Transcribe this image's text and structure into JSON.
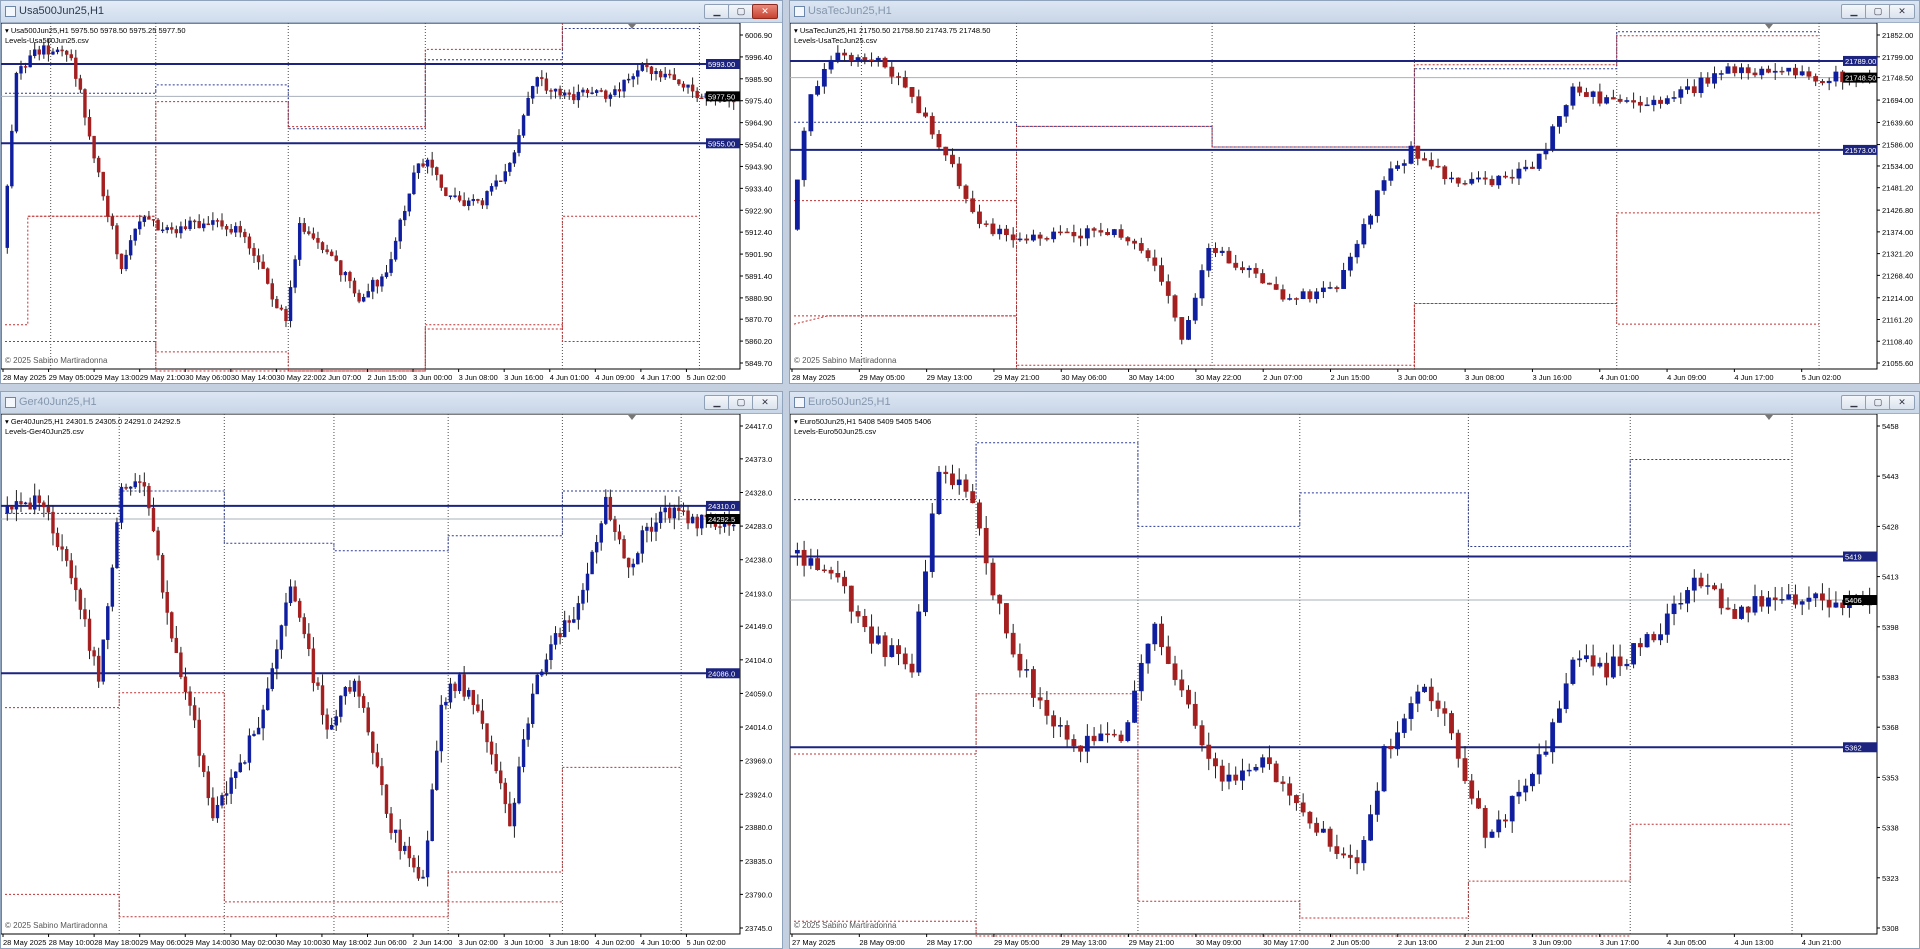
{
  "colors": {
    "bull": "#0f1e9e",
    "bear": "#a41f1f",
    "level": "#1c2480",
    "bid": "#aab0bb",
    "sep": "#4e4e4e",
    "red_dot": "#c03030"
  },
  "windows": [
    {
      "title": "Usa500Jun25,H1"
    },
    {
      "title": "UsaTecJun25,H1"
    },
    {
      "title": "Ger40Jun25,H1"
    },
    {
      "title": "Euro50Jun25,H1"
    }
  ],
  "chart_data": [
    {
      "type": "candlestick",
      "symbol_line": "Usa500Jun25,H1  5975.50 5978.50 5975.25 5977.50",
      "indicator": "Levels-Usa500Jun25.csv",
      "copyright": "© 2025 Sabino Martiradonna",
      "ylim": [
        5849.7,
        6006.9
      ],
      "yticks": [
        "6006.90",
        "5996.40",
        "5985.90",
        "5975.40",
        "5964.90",
        "5954.40",
        "5943.90",
        "5933.40",
        "5922.90",
        "5912.40",
        "5901.90",
        "5891.40",
        "5880.90",
        "5870.70",
        "5860.20",
        "5849.70"
      ],
      "xticks": [
        "28 May 2025",
        "29 May 05:00",
        "29 May 13:00",
        "29 May 21:00",
        "30 May 06:00",
        "30 May 14:00",
        "30 May 22:00",
        "2 Jun 07:00",
        "2 Jun 15:00",
        "3 Jun 00:00",
        "3 Jun 08:00",
        "3 Jun 16:00",
        "4 Jun 01:00",
        "4 Jun 09:00",
        "4 Jun 17:00",
        "5 Jun 02:00"
      ],
      "n_candles": 160,
      "levels": [
        {
          "value": 5993.0,
          "label": "5993.00"
        },
        {
          "value": 5955.0,
          "label": "5955.00"
        }
      ],
      "bid": {
        "value": 5977.5,
        "label": "5977.50"
      },
      "separators": [
        10,
        33,
        62,
        92,
        122,
        152
      ],
      "path": [
        [
          0,
          5905
        ],
        [
          3,
          5990
        ],
        [
          8,
          6000
        ],
        [
          15,
          5998
        ],
        [
          20,
          5950
        ],
        [
          26,
          5895
        ],
        [
          31,
          5922
        ],
        [
          36,
          5912
        ],
        [
          45,
          5918
        ],
        [
          52,
          5913
        ],
        [
          58,
          5888
        ],
        [
          62,
          5868
        ],
        [
          65,
          5915
        ],
        [
          70,
          5905
        ],
        [
          78,
          5882
        ],
        [
          84,
          5892
        ],
        [
          90,
          5940
        ],
        [
          93,
          5948
        ],
        [
          98,
          5928
        ],
        [
          104,
          5925
        ],
        [
          111,
          5945
        ],
        [
          116,
          5985
        ],
        [
          125,
          5978
        ],
        [
          133,
          5978
        ],
        [
          140,
          5990
        ],
        [
          147,
          5987
        ],
        [
          152,
          5978
        ],
        [
          159,
          5977
        ]
      ],
      "red_upper": [
        [
          0,
          null
        ],
        [
          5,
          5920
        ],
        [
          33,
          5920
        ],
        [
          33,
          5975
        ],
        [
          62,
          5975
        ],
        [
          62,
          5963
        ],
        [
          92,
          5963
        ],
        [
          92,
          6000
        ],
        [
          122,
          6000
        ],
        [
          122,
          6015
        ],
        [
          152,
          6015
        ],
        [
          152,
          6030
        ]
      ],
      "red_lower": [
        [
          0,
          5868
        ],
        [
          5,
          5868
        ],
        [
          5,
          5920
        ],
        [
          33,
          5920
        ],
        [
          33,
          5855
        ],
        [
          62,
          5855
        ],
        [
          62,
          5842
        ],
        [
          92,
          5842
        ],
        [
          92,
          5866
        ],
        [
          122,
          5866
        ],
        [
          122,
          5920
        ],
        [
          152,
          5920
        ]
      ],
      "red_lower2": [
        [
          0,
          5860
        ],
        [
          33,
          5860
        ],
        [
          33,
          5845
        ],
        [
          62,
          5845
        ],
        [
          92,
          5845
        ],
        [
          92,
          5868
        ],
        [
          122,
          5868
        ],
        [
          122,
          5860
        ],
        [
          152,
          5860
        ]
      ],
      "upper_dotted_blue": [
        [
          0,
          5979
        ],
        [
          33,
          5979
        ],
        [
          33,
          5983
        ],
        [
          62,
          5983
        ],
        [
          62,
          5962
        ],
        [
          92,
          5962
        ],
        [
          92,
          5995
        ],
        [
          122,
          5995
        ],
        [
          122,
          6010
        ],
        [
          152,
          6010
        ]
      ]
    },
    {
      "type": "candlestick",
      "symbol_line": "UsaTecJun25,H1  21750.50 21758.50 21743.75 21748.50",
      "indicator": "Levels-UsaTecJun25.csv",
      "copyright": "© 2025 Sabino Martiradonna",
      "ylim": [
        21055.6,
        21852.0
      ],
      "yticks": [
        "21852.00",
        "21799.00",
        "21748.50",
        "21694.00",
        "21639.60",
        "21586.00",
        "21534.00",
        "21481.20",
        "21426.80",
        "21374.00",
        "21321.20",
        "21268.40",
        "21214.00",
        "21161.20",
        "21108.40",
        "21055.60"
      ],
      "xticks": [
        "28 May 2025",
        "29 May 05:00",
        "29 May 13:00",
        "29 May 21:00",
        "30 May 06:00",
        "30 May 14:00",
        "30 May 22:00",
        "2 Jun 07:00",
        "2 Jun 15:00",
        "3 Jun 00:00",
        "3 Jun 08:00",
        "3 Jun 16:00",
        "4 Jun 01:00",
        "4 Jun 09:00",
        "4 Jun 17:00",
        "5 Jun 02:00"
      ],
      "n_candles": 160,
      "levels": [
        {
          "value": 21789.0,
          "label": "21789.00"
        },
        {
          "value": 21573.0,
          "label": "21573.00"
        }
      ],
      "bid": {
        "value": 21748.5,
        "label": "21748.50"
      },
      "separators": [
        10,
        33,
        62,
        92,
        122,
        152
      ],
      "path": [
        [
          0,
          21380
        ],
        [
          3,
          21720
        ],
        [
          7,
          21800
        ],
        [
          13,
          21790
        ],
        [
          18,
          21700
        ],
        [
          23,
          21560
        ],
        [
          28,
          21390
        ],
        [
          34,
          21360
        ],
        [
          41,
          21365
        ],
        [
          48,
          21380
        ],
        [
          54,
          21300
        ],
        [
          58,
          21115
        ],
        [
          62,
          21330
        ],
        [
          66,
          21300
        ],
        [
          74,
          21210
        ],
        [
          81,
          21230
        ],
        [
          88,
          21500
        ],
        [
          92,
          21570
        ],
        [
          97,
          21510
        ],
        [
          104,
          21490
        ],
        [
          111,
          21550
        ],
        [
          116,
          21720
        ],
        [
          124,
          21680
        ],
        [
          131,
          21700
        ],
        [
          138,
          21760
        ],
        [
          145,
          21770
        ],
        [
          150,
          21750
        ],
        [
          159,
          21748
        ]
      ],
      "red_upper": [
        [
          0,
          21150
        ],
        [
          5,
          21170
        ],
        [
          33,
          21170
        ],
        [
          33,
          21630
        ],
        [
          62,
          21630
        ],
        [
          62,
          21580
        ],
        [
          92,
          21580
        ],
        [
          92,
          21780
        ],
        [
          122,
          21780
        ],
        [
          122,
          21850
        ],
        [
          152,
          21850
        ]
      ],
      "red_lower": [
        [
          0,
          21450
        ],
        [
          5,
          21450
        ],
        [
          33,
          21450
        ],
        [
          33,
          21050
        ],
        [
          62,
          21050
        ],
        [
          92,
          21050
        ],
        [
          92,
          21200
        ],
        [
          122,
          21200
        ],
        [
          122,
          21420
        ],
        [
          152,
          21420
        ]
      ],
      "red_lower2": [
        [
          0,
          21170
        ],
        [
          33,
          21170
        ],
        [
          33,
          21040
        ],
        [
          62,
          21040
        ],
        [
          92,
          21040
        ],
        [
          92,
          21200
        ],
        [
          122,
          21200
        ],
        [
          122,
          21150
        ],
        [
          152,
          21150
        ]
      ],
      "upper_dotted_blue": [
        [
          0,
          21640
        ],
        [
          33,
          21640
        ],
        [
          33,
          21630
        ],
        [
          62,
          21630
        ],
        [
          62,
          21580
        ],
        [
          92,
          21580
        ],
        [
          92,
          21770
        ],
        [
          122,
          21770
        ],
        [
          122,
          21860
        ],
        [
          152,
          21860
        ]
      ]
    },
    {
      "type": "candlestick",
      "symbol_line": "Ger40Jun25,H1  24301.5 24305.0 24291.0 24292.5",
      "indicator": "Levels-Ger40Jun25.csv",
      "copyright": "© 2025 Sabino Martiradonna",
      "ylim": [
        23745.0,
        24417.0
      ],
      "yticks": [
        "24417.0",
        "24373.0",
        "24328.0",
        "24283.0",
        "24238.0",
        "24193.0",
        "24149.0",
        "24104.0",
        "24059.0",
        "24014.0",
        "23969.0",
        "23924.0",
        "23880.0",
        "23835.0",
        "23790.0",
        "23745.0"
      ],
      "xticks": [
        "28 May 2025",
        "28 May 10:00",
        "28 May 18:00",
        "29 May 06:00",
        "29 May 14:00",
        "30 May 02:00",
        "30 May 10:00",
        "30 May 18:00",
        "2 Jun 06:00",
        "2 Jun 14:00",
        "3 Jun 02:00",
        "3 Jun 10:00",
        "3 Jun 18:00",
        "4 Jun 02:00",
        "4 Jun 10:00",
        "5 Jun 02:00"
      ],
      "n_candles": 160,
      "levels": [
        {
          "value": 24310.0,
          "label": "24310.0"
        },
        {
          "value": 24086.0,
          "label": "24086.0"
        }
      ],
      "bid": {
        "value": 24292.5,
        "label": "24292.5"
      },
      "separators": [
        25,
        48,
        72,
        97,
        122,
        148
      ],
      "path": [
        [
          0,
          24300
        ],
        [
          8,
          24320
        ],
        [
          14,
          24230
        ],
        [
          21,
          24085
        ],
        [
          26,
          24340
        ],
        [
          31,
          24340
        ],
        [
          36,
          24170
        ],
        [
          41,
          24040
        ],
        [
          46,
          23900
        ],
        [
          52,
          23960
        ],
        [
          57,
          24040
        ],
        [
          63,
          24210
        ],
        [
          71,
          24010
        ],
        [
          77,
          24080
        ],
        [
          85,
          23880
        ],
        [
          92,
          23810
        ],
        [
          96,
          24040
        ],
        [
          100,
          24080
        ],
        [
          106,
          24000
        ],
        [
          111,
          23885
        ],
        [
          116,
          24060
        ],
        [
          121,
          24130
        ],
        [
          126,
          24170
        ],
        [
          132,
          24320
        ],
        [
          137,
          24220
        ],
        [
          140,
          24270
        ],
        [
          145,
          24300
        ],
        [
          152,
          24292
        ]
      ],
      "red_upper": [
        [
          0,
          24040
        ],
        [
          25,
          24040
        ],
        [
          25,
          24060
        ],
        [
          48,
          24060
        ],
        [
          48,
          23780
        ],
        [
          97,
          23780
        ],
        [
          97,
          23820
        ],
        [
          122,
          23820
        ],
        [
          122,
          23960
        ],
        [
          148,
          23960
        ]
      ],
      "red_lower": [
        [
          0,
          23790
        ],
        [
          25,
          23790
        ],
        [
          25,
          23760
        ],
        [
          48,
          23760
        ],
        [
          72,
          23760
        ],
        [
          97,
          23760
        ],
        [
          97,
          23780
        ],
        [
          122,
          23780
        ]
      ],
      "upper_dotted_blue": [
        [
          0,
          24300
        ],
        [
          25,
          24300
        ],
        [
          25,
          24330
        ],
        [
          48,
          24330
        ],
        [
          48,
          24260
        ],
        [
          72,
          24260
        ],
        [
          72,
          24250
        ],
        [
          97,
          24250
        ],
        [
          97,
          24270
        ],
        [
          122,
          24270
        ],
        [
          122,
          24330
        ],
        [
          148,
          24330
        ]
      ]
    },
    {
      "type": "candlestick",
      "symbol_line": "Euro50Jun25,H1  5408 5409 5405 5406",
      "indicator": "Levels-Euro50Jun25.csv",
      "copyright": "© 2025 Sabino Martiradonna",
      "ylim": [
        5308,
        5458
      ],
      "yticks": [
        "5458",
        "5443",
        "5428",
        "5413",
        "5398",
        "5383",
        "5368",
        "5353",
        "5338",
        "5323",
        "5308"
      ],
      "xticks": [
        "27 May 2025",
        "28 May 09:00",
        "28 May 17:00",
        "29 May 05:00",
        "29 May 13:00",
        "29 May 21:00",
        "30 May 09:00",
        "30 May 17:00",
        "2 Jun 05:00",
        "2 Jun 13:00",
        "2 Jun 21:00",
        "3 Jun 09:00",
        "3 Jun 17:00",
        "4 Jun 05:00",
        "4 Jun 13:00",
        "4 Jun 21:00"
      ],
      "n_candles": 160,
      "levels": [
        {
          "value": 5419,
          "label": "5419"
        },
        {
          "value": 5362,
          "label": "5362"
        }
      ],
      "bid": {
        "value": 5406,
        "label": "5406"
      },
      "separators": [
        27,
        51,
        75,
        100,
        124,
        148
      ],
      "path": [
        [
          0,
          5420
        ],
        [
          6,
          5415
        ],
        [
          12,
          5395
        ],
        [
          18,
          5385
        ],
        [
          22,
          5445
        ],
        [
          26,
          5440
        ],
        [
          32,
          5395
        ],
        [
          37,
          5375
        ],
        [
          42,
          5362
        ],
        [
          49,
          5365
        ],
        [
          54,
          5398
        ],
        [
          58,
          5380
        ],
        [
          64,
          5350
        ],
        [
          70,
          5360
        ],
        [
          77,
          5340
        ],
        [
          84,
          5325
        ],
        [
          88,
          5360
        ],
        [
          93,
          5380
        ],
        [
          97,
          5372
        ],
        [
          103,
          5335
        ],
        [
          107,
          5345
        ],
        [
          112,
          5362
        ],
        [
          116,
          5390
        ],
        [
          121,
          5385
        ],
        [
          128,
          5395
        ],
        [
          134,
          5412
        ],
        [
          140,
          5402
        ],
        [
          146,
          5408
        ],
        [
          150,
          5406
        ]
      ],
      "red_upper": [
        [
          0,
          5360
        ],
        [
          27,
          5360
        ],
        [
          27,
          5378
        ],
        [
          51,
          5378
        ],
        [
          51,
          5316
        ],
        [
          75,
          5316
        ],
        [
          75,
          5311
        ],
        [
          100,
          5311
        ],
        [
          100,
          5322
        ],
        [
          124,
          5322
        ],
        [
          124,
          5339
        ],
        [
          148,
          5339
        ]
      ],
      "red_lower": [
        [
          0,
          5310
        ],
        [
          27,
          5310
        ],
        [
          27,
          5290
        ],
        [
          51,
          5290
        ],
        [
          75,
          5290
        ],
        [
          100,
          5290
        ],
        [
          100,
          5305
        ],
        [
          124,
          5305
        ]
      ],
      "upper_dotted_blue": [
        [
          0,
          5436
        ],
        [
          27,
          5436
        ],
        [
          27,
          5453
        ],
        [
          51,
          5453
        ],
        [
          51,
          5428
        ],
        [
          75,
          5428
        ],
        [
          75,
          5438
        ],
        [
          100,
          5438
        ],
        [
          100,
          5422
        ],
        [
          124,
          5422
        ],
        [
          124,
          5448
        ],
        [
          148,
          5448
        ]
      ]
    }
  ]
}
